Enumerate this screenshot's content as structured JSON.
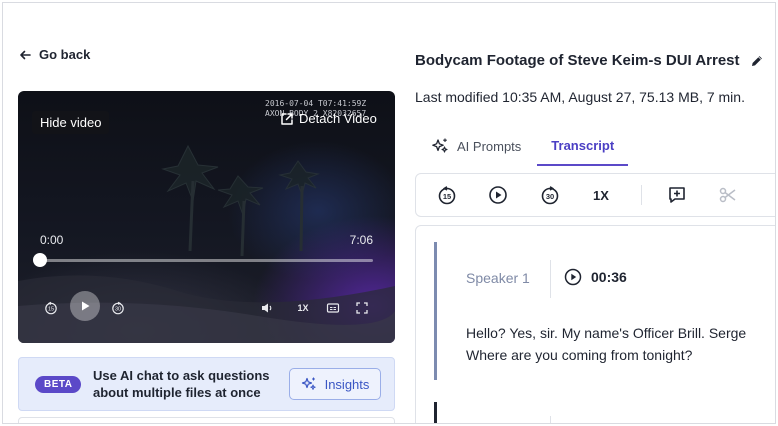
{
  "nav": {
    "go_back": "Go back"
  },
  "video": {
    "hide_label": "Hide video",
    "timestamp_line1": "2016-07-04 T07:41:59Z",
    "timestamp_line2": "AXON BODY 2 X82032657",
    "detach_label": "Detach Video",
    "current_time": "0:00",
    "duration": "7:06",
    "progress": 0.0,
    "speed": "1X"
  },
  "beta": {
    "badge": "BETA",
    "message": "Use AI chat to ask questions about multiple files at once",
    "button": "Insights"
  },
  "file": {
    "title": "Bodycam Footage of Steve Keim-s DUI Arrest",
    "meta": "Last modified 10:35 AM, August 27, 75.13 MB, 7 min."
  },
  "tabs": [
    {
      "label": "AI Prompts",
      "active": false
    },
    {
      "label": "Transcript",
      "active": true
    }
  ],
  "toolbar": {
    "speed": "1X"
  },
  "transcript": {
    "segments": [
      {
        "speaker": "Speaker 1",
        "time": "00:36",
        "text_line1": "Hello? Yes, sir. My name's Officer Brill. Serge",
        "text_line2": "Where are you coming from tonight?"
      }
    ]
  },
  "colors": {
    "accent": "#5b49c8",
    "beta_bg": "#e6ecfb",
    "insights_text": "#3a56c4"
  },
  "icons": {
    "back": "arrow-left-icon",
    "detach": "external-link-icon",
    "edit": "pencil-icon",
    "ai_prompts": "sparkles-icon",
    "insights": "sparkles-icon",
    "rewind": "rewind-15-icon",
    "forward": "forward-30-icon",
    "play": "play-icon",
    "add_comment": "add-comment-icon",
    "cut": "scissors-icon"
  }
}
